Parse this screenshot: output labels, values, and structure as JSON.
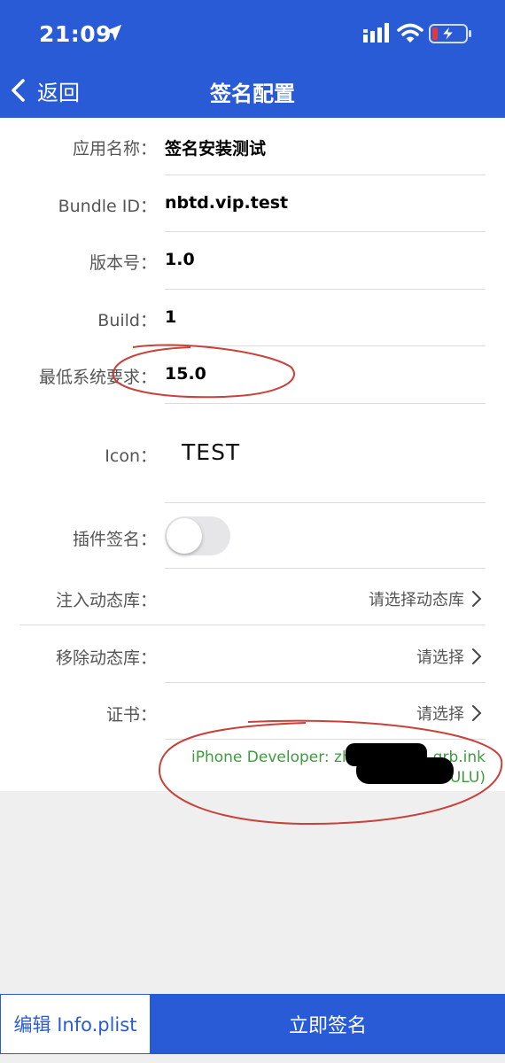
{
  "status_bar": {
    "time": "21:09",
    "icons": [
      "location-arrow-icon",
      "cellular-signal-icon",
      "wifi-icon",
      "battery-charging-icon"
    ]
  },
  "nav": {
    "back_label": "返回",
    "title": "签名配置"
  },
  "form": {
    "app_name": {
      "label": "应用名称：",
      "value": "签名安装测试"
    },
    "bundle_id": {
      "label": "Bundle ID：",
      "value": "nbtd.vip.test"
    },
    "version": {
      "label": "版本号：",
      "value": "1.0"
    },
    "build": {
      "label": "Build：",
      "value": "1"
    },
    "min_os": {
      "label": "最低系统要求：",
      "value": "15.0"
    },
    "icon": {
      "label": "Icon：",
      "preview_text": "TEST"
    },
    "plugin_sign": {
      "label": "插件签名：",
      "enabled": false
    },
    "inject_dylib": {
      "label": "注入动态库：",
      "picker": "请选择动态库"
    },
    "remove_dylib": {
      "label": "移除动态库：",
      "picker": "请选择"
    },
    "certificate": {
      "label": "证书：",
      "picker": "请选择",
      "line1_visible": "iPhone Developer: zh",
      "line1_tail": "qrb.ink",
      "line2_tail": "ULU)"
    }
  },
  "colors": {
    "brand_blue": "#2a5bd7",
    "cert_green": "#3f9a3f",
    "annotation_red": "#c8413a"
  },
  "bottom": {
    "edit_plist_label": "编辑 Info.plist",
    "sign_now_label": "立即签名"
  }
}
